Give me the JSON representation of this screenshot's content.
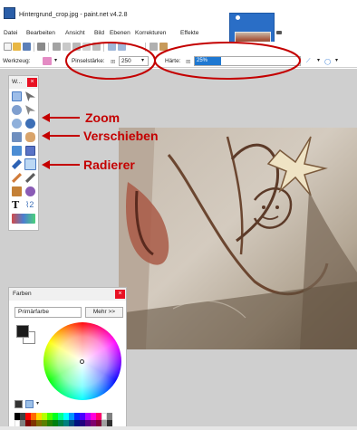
{
  "window": {
    "title": "Hintergrund_crop.jpg - paint.net v4.2.8"
  },
  "menu": [
    "Datei",
    "Bearbeiten",
    "Ansicht",
    "Bild",
    "Ebenen",
    "Korrekturen",
    "Effekte"
  ],
  "options": {
    "tool_label": "Werkzeug:",
    "brush_label": "Pinselstärke:",
    "brush_value": "250",
    "hardness_label": "Härte:",
    "hardness_value": "25%",
    "hardness_fraction": 0.25
  },
  "tools_panel": {
    "title": "W...",
    "close": "×"
  },
  "callouts": {
    "zoom": "Zoom",
    "move": "Verschieben",
    "eraser": "Radierer"
  },
  "colors_panel": {
    "title": "Farben",
    "close": "×",
    "select_value": "Primärfarbe",
    "more_button": "Mehr >>"
  },
  "colors": {
    "accent": "#1f78d1",
    "annotation": "#c40000",
    "close_red": "#e81123"
  }
}
